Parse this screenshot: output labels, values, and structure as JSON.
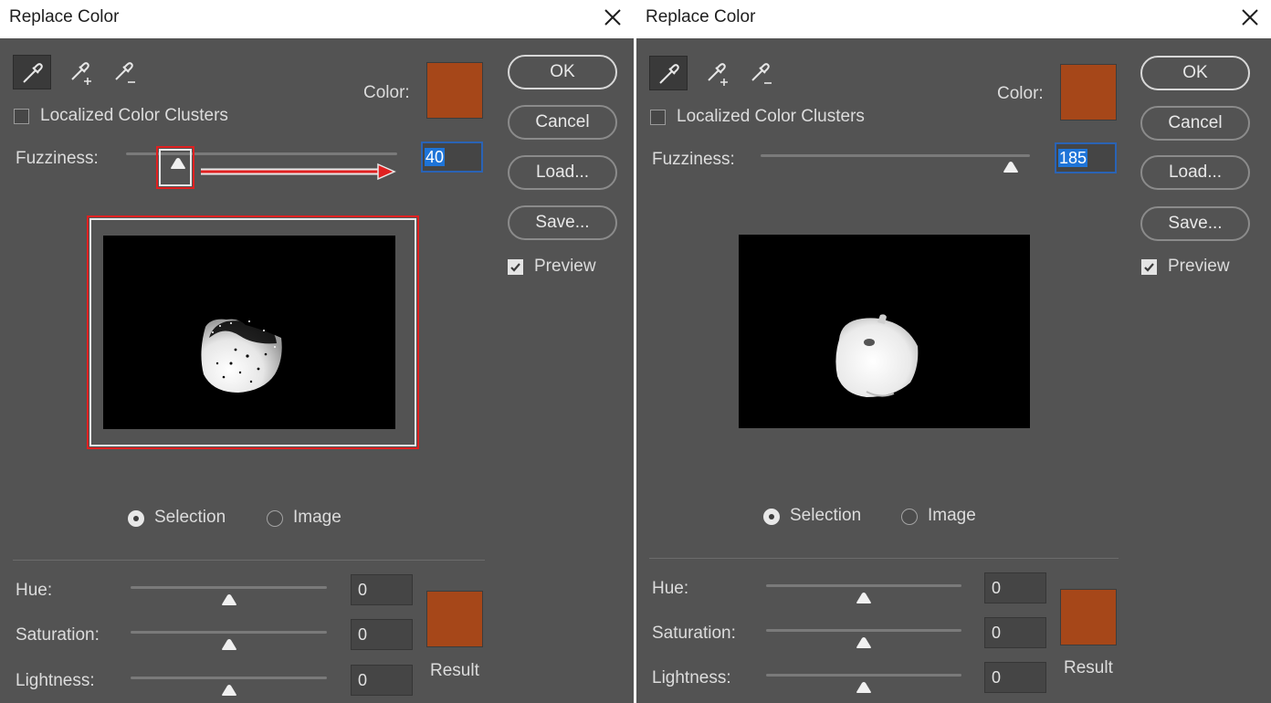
{
  "dialogs": [
    {
      "title": "Replace Color",
      "color_label": "Color:",
      "color_hex": "#a64719",
      "localized_label": "Localized Color Clusters",
      "localized_checked": false,
      "fuzziness_label": "Fuzziness:",
      "fuzziness_value": "40",
      "fuzziness_level": 0.2,
      "buttons": {
        "ok": "OK",
        "cancel": "Cancel",
        "load": "Load...",
        "save": "Save..."
      },
      "preview_label": "Preview",
      "preview_checked": true,
      "view_selection_label": "Selection",
      "view_image_label": "Image",
      "view_selected": "Selection",
      "hue_label": "Hue:",
      "hue_value": "0",
      "saturation_label": "Saturation:",
      "saturation_value": "0",
      "lightness_label": "Lightness:",
      "lightness_value": "0",
      "result_label": "Result",
      "result_hex": "#a64719",
      "annotations": {
        "highlight_color": "#e02020"
      }
    },
    {
      "title": "Replace Color",
      "color_label": "Color:",
      "color_hex": "#a64719",
      "localized_label": "Localized Color Clusters",
      "localized_checked": false,
      "fuzziness_label": "Fuzziness:",
      "fuzziness_value": "185",
      "fuzziness_level": 0.925,
      "buttons": {
        "ok": "OK",
        "cancel": "Cancel",
        "load": "Load...",
        "save": "Save..."
      },
      "preview_label": "Preview",
      "preview_checked": true,
      "view_selection_label": "Selection",
      "view_image_label": "Image",
      "view_selected": "Selection",
      "hue_label": "Hue:",
      "hue_value": "0",
      "saturation_label": "Saturation:",
      "saturation_value": "0",
      "lightness_label": "Lightness:",
      "lightness_value": "0",
      "result_label": "Result",
      "result_hex": "#a64719"
    }
  ],
  "icons": {
    "close": "close-icon",
    "eyedropper": "eyedropper-icon",
    "eyedropper_add": "eyedropper-plus-icon",
    "eyedropper_subtract": "eyedropper-minus-icon",
    "checkmark": "checkmark-icon",
    "slider_thumb": "slider-thumb-icon"
  }
}
